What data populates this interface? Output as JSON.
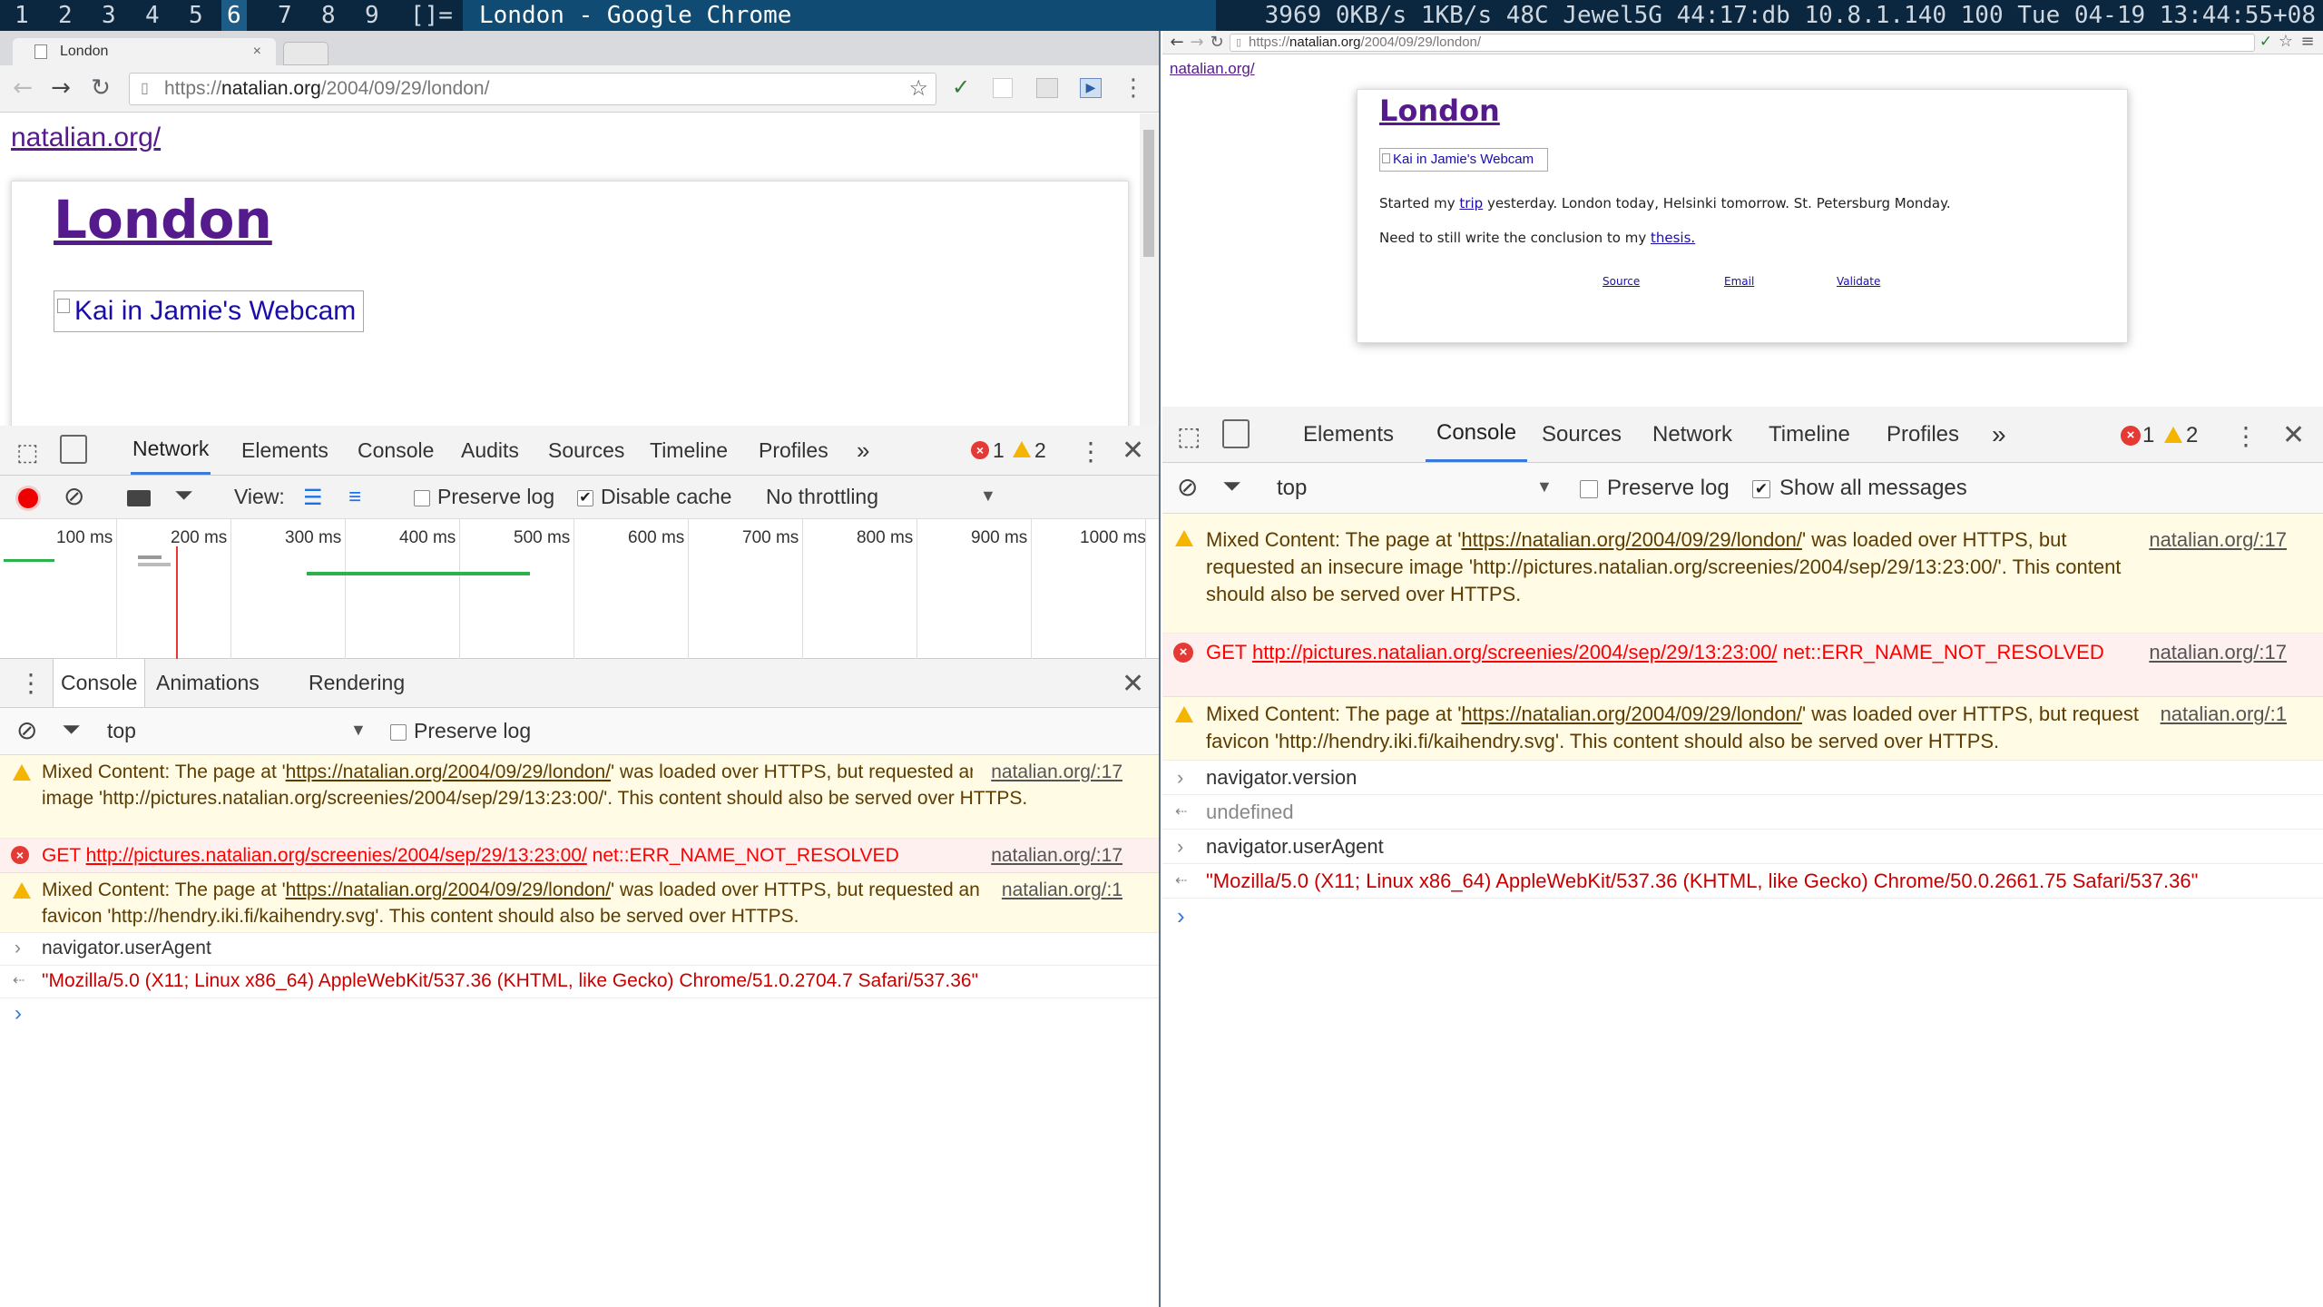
{
  "topbar": {
    "workspaces": [
      "1",
      "2",
      "3",
      "4",
      "5",
      "6",
      "7",
      "8",
      "9"
    ],
    "active_workspace": "6",
    "layout_symbol": "[]=",
    "window_title": "London - Google Chrome",
    "stats": "3969 0KB/s 1KB/s 48C Jewel5G 44:17:db 10.8.1.140 100 Tue 04-19 13:44:55+08"
  },
  "left": {
    "tab_title": "London",
    "url_prefix": "https://",
    "url_host": "natalian.org",
    "url_path": "/2004/09/29/london/",
    "page": {
      "home_link": "natalian.org/",
      "heading": "London",
      "image_alt": "Kai in Jamie's Webcam"
    },
    "devtools_tabs": [
      "Network",
      "Elements",
      "Console",
      "Audits",
      "Sources",
      "Timeline",
      "Profiles"
    ],
    "error_count": "1",
    "warning_count": "2",
    "network_toolbar": {
      "view_label": "View:",
      "preserve_log": "Preserve log",
      "disable_cache": "Disable cache",
      "throttling": "No throttling"
    },
    "timeline_ticks": [
      "100 ms",
      "200 ms",
      "300 ms",
      "400 ms",
      "500 ms",
      "600 ms",
      "700 ms",
      "800 ms",
      "900 ms",
      "1000 ms"
    ],
    "drawer_tabs": [
      "Console",
      "Animations",
      "Rendering"
    ],
    "console_filter": {
      "context": "top",
      "preserve_log": "Preserve log"
    },
    "messages": [
      {
        "type": "warn",
        "pre": "Mixed Content: The page at '",
        "url": "https://natalian.org/2004/09/29/london/",
        "post": "' was loaded over HTTPS, but requested an insecure image 'http://pictures.natalian.org/screenies/2004/sep/29/13:23:00/'. This content should also be served over HTTPS.",
        "source": "natalian.org/:17"
      },
      {
        "type": "err",
        "pre": "GET ",
        "url": "http://pictures.natalian.org/screenies/2004/sep/29/13:23:00/",
        "post": " net::ERR_NAME_NOT_RESOLVED",
        "source": "natalian.org/:17"
      },
      {
        "type": "warn",
        "pre": "Mixed Content: The page at '",
        "url": "https://natalian.org/2004/09/29/london/",
        "post": "' was loaded over HTTPS, but requested an insecure favicon 'http://hendry.iki.fi/kaihendry.svg'. This content should also be served over HTTPS.",
        "source": "natalian.org/:1"
      }
    ],
    "input": "navigator.userAgent",
    "output": "\"Mozilla/5.0 (X11; Linux x86_64) AppleWebKit/537.36 (KHTML, like Gecko) Chrome/51.0.2704.7 Safari/537.36\""
  },
  "right": {
    "url_prefix": "https://",
    "url_host": "natalian.org",
    "url_path": "/2004/09/29/london/",
    "page": {
      "home_link": "natalian.org/",
      "heading": "London",
      "image_alt": "Kai in Jamie's Webcam",
      "para1_pre": "Started my ",
      "para1_link": "trip",
      "para1_post": " yesterday. London today, Helsinki tomorrow. St. Petersburg Monday.",
      "para2_pre": "Need to still write the conclusion to my ",
      "para2_link": "thesis.",
      "footer_links": [
        "Source",
        "Email",
        "Validate"
      ]
    },
    "devtools_tabs": [
      "Elements",
      "Console",
      "Sources",
      "Network",
      "Timeline",
      "Profiles"
    ],
    "error_count": "1",
    "warning_count": "2",
    "console_filter": {
      "context": "top",
      "preserve_log": "Preserve log",
      "show_all": "Show all messages"
    },
    "messages": [
      {
        "type": "warn",
        "pre": "Mixed Content: The page at '",
        "url": "https://natalian.org/2004/09/29/london/",
        "post": "' was loaded over HTTPS, but requested an insecure image 'http://pictures.natalian.org/screenies/2004/sep/29/13:23:00/'. This content should also be served over HTTPS.",
        "source": "natalian.org/:17"
      },
      {
        "type": "err",
        "pre": "GET ",
        "url": "http://pictures.natalian.org/screenies/2004/sep/29/13:23:00/",
        "post": " net::ERR_NAME_NOT_RESOLVED",
        "source": "natalian.org/:17"
      },
      {
        "type": "warn",
        "pre": "Mixed Content: The page at '",
        "url": "https://natalian.org/2004/09/29/london/",
        "post": "' was loaded over HTTPS, but requested an insecure favicon 'http://hendry.iki.fi/kaihendry.svg'. This content should also be served over HTTPS.",
        "source": "natalian.org/:1"
      }
    ],
    "input1": "navigator.version",
    "output1": "undefined",
    "input2": "navigator.userAgent",
    "output2": "\"Mozilla/5.0 (X11; Linux x86_64) AppleWebKit/537.36 (KHTML, like Gecko) Chrome/50.0.2661.75 Safari/537.36\""
  }
}
